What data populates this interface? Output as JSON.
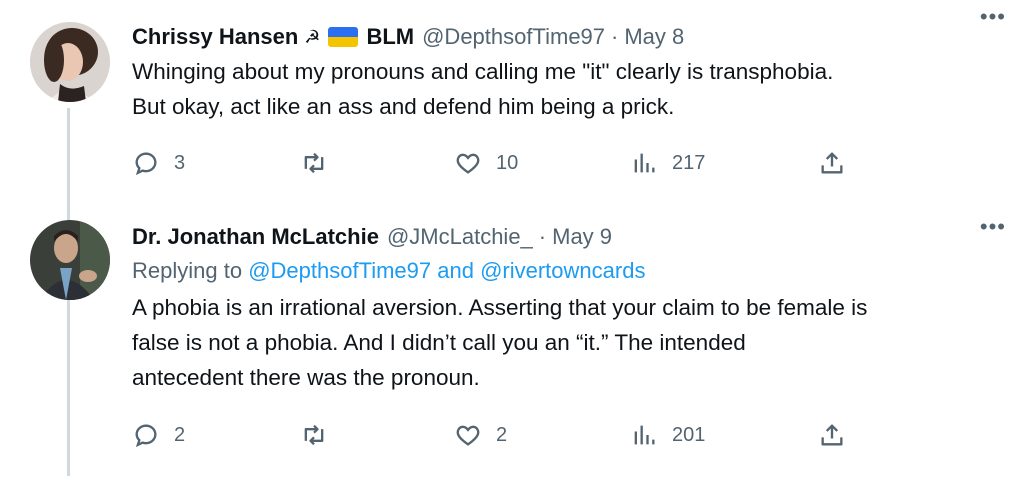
{
  "tweets": [
    {
      "name": "Chrissy Hansen",
      "emoji_symbol": "☭",
      "emoji_flag": "ukraine-flag",
      "name_suffix": "BLM",
      "handle": "@DepthsofTime97",
      "separator": "·",
      "date": "May 8",
      "more": "•••",
      "text_lines": [
        "Whinging about my pronouns and calling me \"it\" clearly is transphobia.",
        "But okay, act like an ass and defend him being a prick."
      ],
      "stats": {
        "replies": "3",
        "retweets": "",
        "likes": "10",
        "views": "217"
      }
    },
    {
      "name": "Dr. Jonathan McLatchie",
      "handle": "@JMcLatchie_",
      "separator": "·",
      "date": "May 9",
      "more": "•••",
      "replying_prefix": "Replying to ",
      "replying_user1": "@DepthsofTime97",
      "replying_and": " and ",
      "replying_user2": "@rivertowncards",
      "text_lines": [
        "A phobia is an irrational aversion. Asserting that your claim to be female is",
        "false is not a phobia. And I didn’t call you an “it.” The intended",
        "antecedent there was the pronoun."
      ],
      "stats": {
        "replies": "2",
        "retweets": "",
        "likes": "2",
        "views": "201"
      }
    }
  ],
  "colors": {
    "text": "#0f1419",
    "secondary": "#536471",
    "link": "#1d9bf0",
    "thread_line": "#cfd9de"
  },
  "icons": [
    "reply-icon",
    "retweet-icon",
    "like-icon",
    "views-icon",
    "share-icon",
    "more-icon"
  ]
}
